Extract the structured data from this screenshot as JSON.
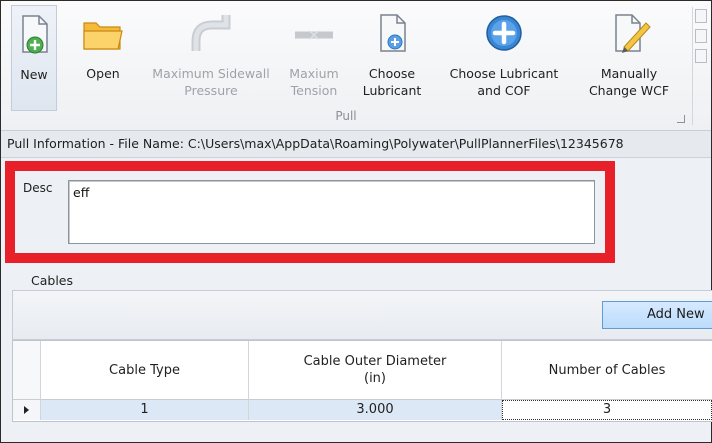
{
  "ribbon": {
    "buttons": [
      {
        "id": "new",
        "label": "New",
        "icon": "new-document-icon",
        "enabled": true
      },
      {
        "id": "open",
        "label": "Open",
        "icon": "folder-icon",
        "enabled": true
      },
      {
        "id": "max_sidewall",
        "label": "Maximum Sidewall\nPressure",
        "icon": "pipe-bend-icon",
        "enabled": false
      },
      {
        "id": "max_tension",
        "label": "Maxium\nTension",
        "icon": "tension-icon",
        "enabled": false
      },
      {
        "id": "choose_lubricant",
        "label": "Choose\nLubricant",
        "icon": "add-document-icon",
        "enabled": true
      },
      {
        "id": "choose_lub_cof",
        "label": "Choose Lubricant\nand COF",
        "icon": "plus-circle-icon",
        "enabled": true
      },
      {
        "id": "manual_wcf",
        "label": "Manually\nChange WCF",
        "icon": "edit-document-icon",
        "enabled": true
      }
    ],
    "group_label": "Pull"
  },
  "info_bar": {
    "text": "Pull Information - File Name: C:\\Users\\max\\AppData\\Roaming\\Polywater\\PullPlannerFiles\\12345678"
  },
  "description": {
    "label": "Desc",
    "value": "eff"
  },
  "cables": {
    "section_label": "Cables",
    "add_button_label": "Add New",
    "columns": [
      "Cable Type",
      "Cable Outer Diameter\n(in)",
      "Number of Cables"
    ],
    "rows": [
      {
        "cable_type": "1",
        "outer_diameter": "3.000",
        "count": "3"
      }
    ]
  },
  "colors": {
    "highlight": "#e8202a",
    "accent_blue": "#3b86d4",
    "selected_row": "#dde8f6"
  }
}
